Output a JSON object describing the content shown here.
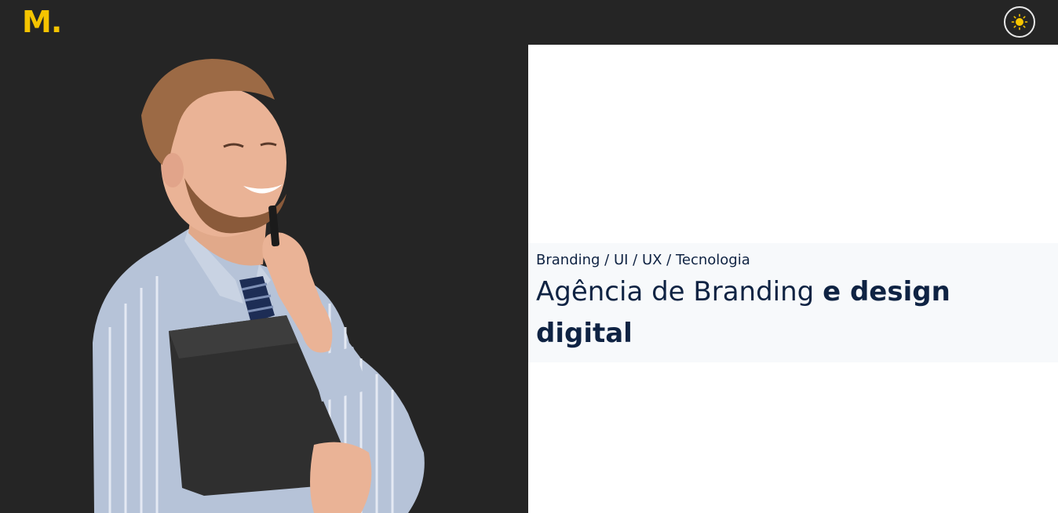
{
  "colors": {
    "background_dark": "#252525",
    "brand_yellow": "#f5c400",
    "panel_white": "#ffffff",
    "band": "#f7f9fb",
    "text_navy": "#0f2343",
    "toggle_border": "#e8e8e8"
  },
  "header": {
    "logo_text": "M.",
    "theme_toggle_icon": "sun-icon"
  },
  "hero": {
    "image_subject": "smiling man in striped shirt holding a pen and a black folder",
    "eyebrow": "Branding / UI / UX / Tecnologia",
    "headline_regular": "Agência de Branding ",
    "headline_bold": "e design digital"
  }
}
